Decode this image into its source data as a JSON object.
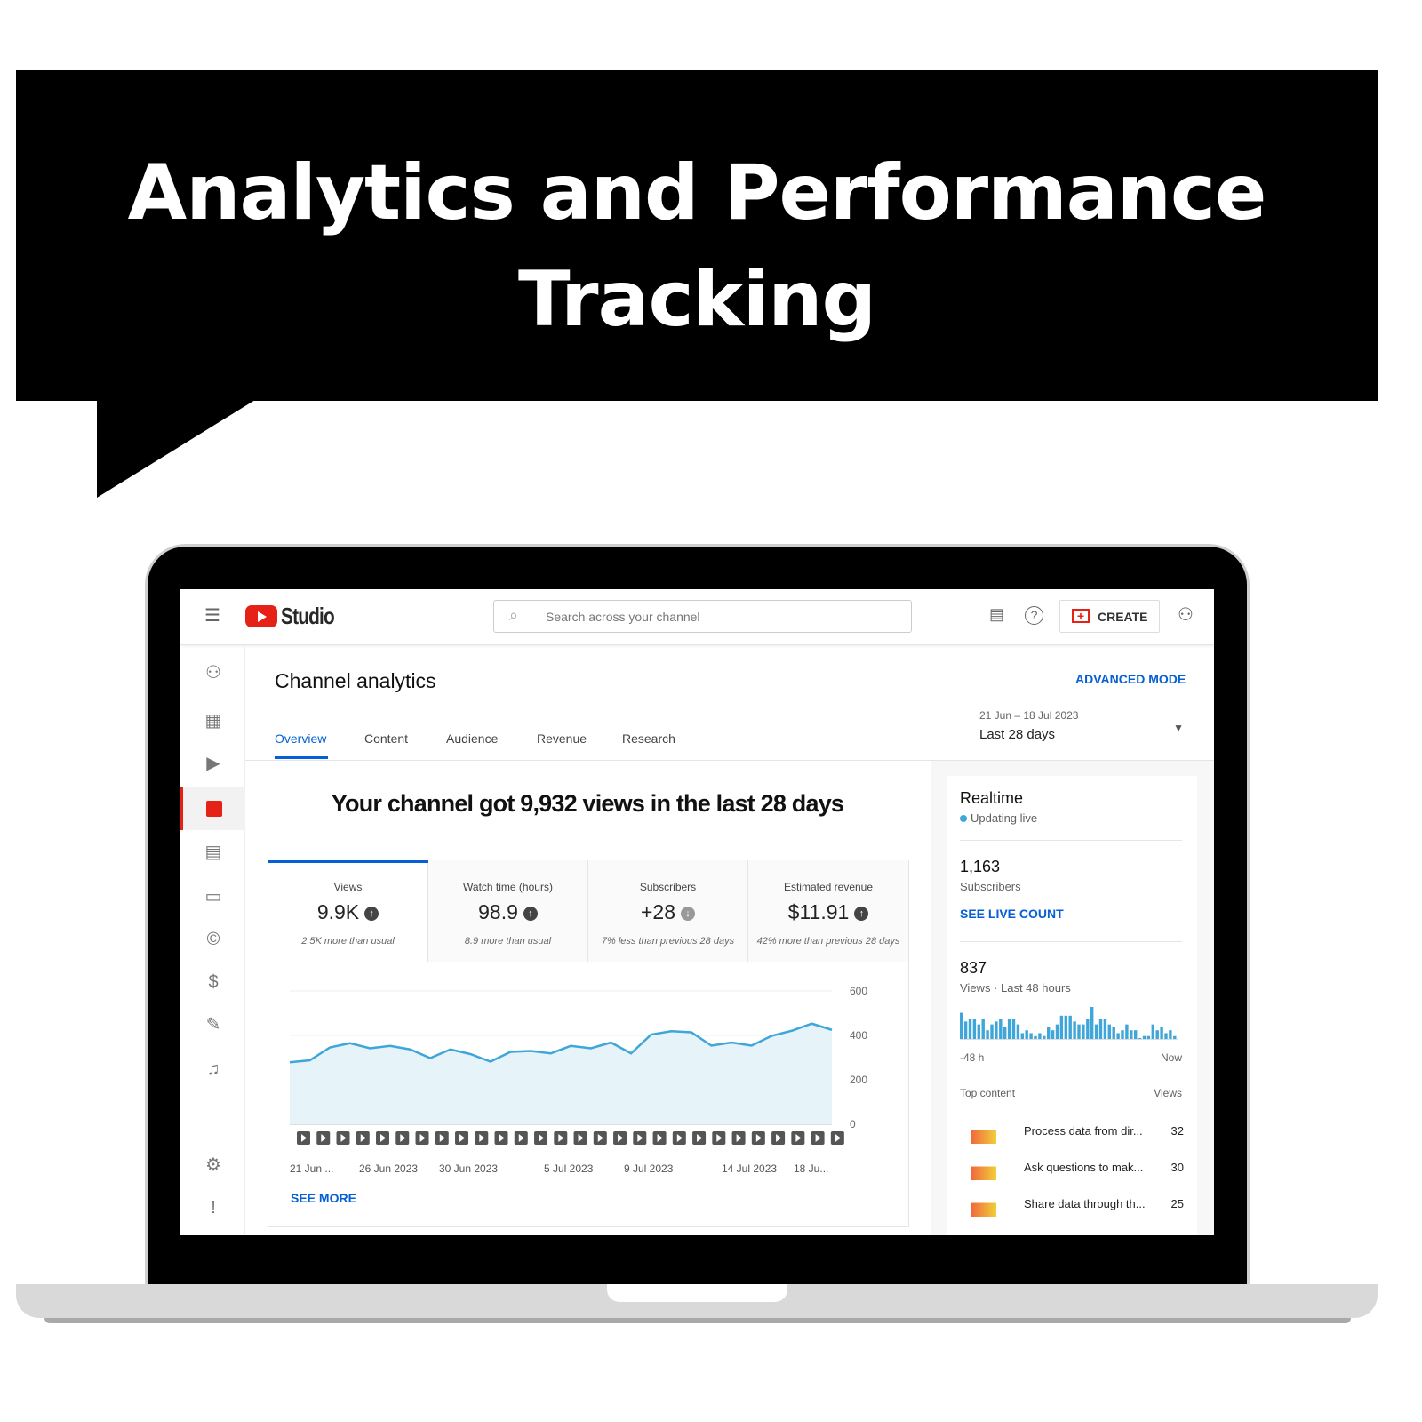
{
  "banner": {
    "title_line1": "Analytics and Performance",
    "title_line2": "Tracking"
  },
  "app": {
    "logo_text": "Studio",
    "search_placeholder": "Search across your channel",
    "create_label": "CREATE",
    "brand_color": "#ff0000",
    "accent_color": "#065fd4"
  },
  "page": {
    "title": "Channel analytics",
    "advanced_mode": "ADVANCED MODE",
    "date_range": "21 Jun – 18 Jul 2023",
    "period": "Last 28 days"
  },
  "tabs": [
    {
      "label": "Overview",
      "active": true
    },
    {
      "label": "Content"
    },
    {
      "label": "Audience"
    },
    {
      "label": "Revenue"
    },
    {
      "label": "Research"
    }
  ],
  "headline": "Your channel got 9,932 views in the last 28 days",
  "metrics": [
    {
      "label": "Views",
      "value": "9.9K",
      "trend": "up",
      "note": "2.5K more than usual"
    },
    {
      "label": "Watch time (hours)",
      "value": "98.9",
      "trend": "up",
      "note": "8.9 more than usual"
    },
    {
      "label": "Subscribers",
      "value": "+28",
      "trend": "down",
      "note": "7% less than previous 28 days"
    },
    {
      "label": "Estimated revenue",
      "value": "$11.91",
      "trend": "up",
      "note": "42% more than previous 28 days"
    }
  ],
  "see_more": "SEE MORE",
  "chart_data": {
    "type": "area",
    "ylim": [
      0,
      600
    ],
    "yticks": [
      "600",
      "400",
      "200",
      "0"
    ],
    "xticks": [
      "21 Jun ...",
      "26 Jun 2023",
      "30 Jun 2023",
      "5 Jul 2023",
      "9 Jul 2023",
      "14 Jul 2023",
      "18 Ju..."
    ],
    "values": [
      279,
      288,
      346,
      365,
      342,
      353,
      337,
      298,
      337,
      316,
      282,
      326,
      330,
      319,
      353,
      342,
      368,
      319,
      404,
      419,
      414,
      354,
      368,
      354,
      398,
      421,
      453,
      425
    ],
    "line_color": "#3ea6d8",
    "fill_color": "#e6f4fa"
  },
  "realtime": {
    "title": "Realtime",
    "status": "Updating live",
    "subscribers": "1,163",
    "subscribers_label": "Subscribers",
    "see_live": "SEE LIVE COUNT",
    "views": "837",
    "views_label": "Views · Last 48 hours",
    "axis_start": "-48 h",
    "axis_end": "Now",
    "bars": [
      9,
      6,
      7,
      7,
      5,
      7,
      3,
      5,
      6,
      7,
      4,
      7,
      7,
      5,
      2,
      3,
      2,
      1,
      2,
      1,
      4,
      3,
      5,
      8,
      8,
      8,
      6,
      5,
      5,
      7,
      11,
      5,
      7,
      7,
      5,
      4,
      2,
      3,
      5,
      3,
      3,
      0,
      1,
      1,
      5,
      3,
      4,
      2,
      3,
      1
    ],
    "top_content_label": "Top content",
    "views_col": "Views",
    "top_content": [
      {
        "title": "Process data from dir...",
        "views": "32"
      },
      {
        "title": "Ask questions to mak...",
        "views": "30"
      },
      {
        "title": "Share data through th...",
        "views": "25"
      }
    ]
  }
}
